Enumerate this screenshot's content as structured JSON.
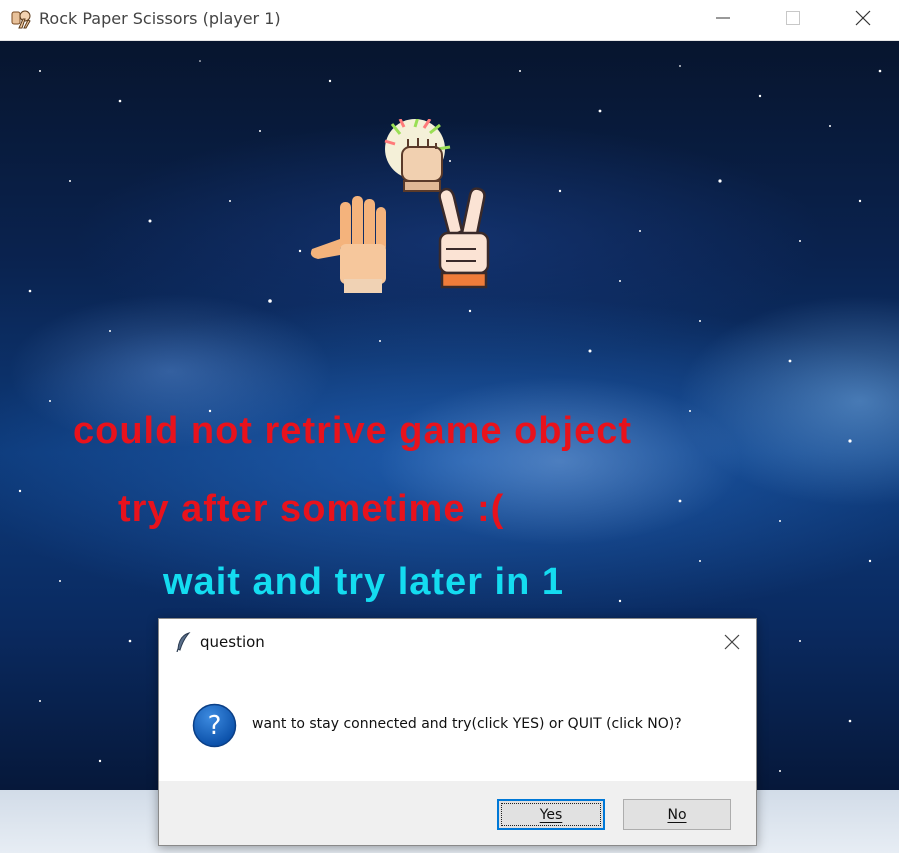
{
  "window": {
    "title": "Rock Paper Scissors (player 1)",
    "icon": "rock-paper-scissors-app-icon",
    "controls": [
      "minimize-icon",
      "maximize-icon",
      "close-icon"
    ]
  },
  "game": {
    "hands_icons": [
      "rock-fist-icon",
      "paper-hand-icon",
      "scissors-hand-icon"
    ],
    "error_line_1": "could not retrive game object",
    "error_line_2": "try after sometime :(",
    "wait_text": "wait and try later in 1",
    "colors": {
      "error": "#e8121c",
      "wait": "#14dcf0"
    }
  },
  "dialog": {
    "title": "question",
    "title_icon": "feather-icon",
    "icon": "question-mark-icon",
    "message": "want to stay connected and try(click YES) or QUIT (click NO)?",
    "yes_label": "Yes",
    "no_label": "No",
    "focused_button": "Yes",
    "accent": "#0078d7"
  }
}
